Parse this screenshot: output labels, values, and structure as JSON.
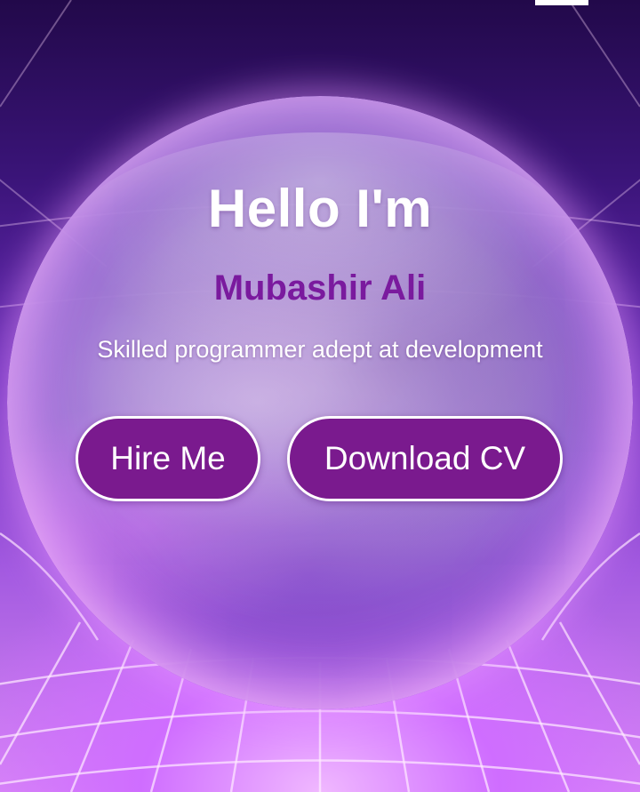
{
  "hero": {
    "greeting": "Hello I'm",
    "name": "Mubashir Ali",
    "tagline": "Skilled programmer adept at development"
  },
  "actions": {
    "hire_label": "Hire Me",
    "download_label": "Download CV"
  },
  "colors": {
    "accent": "#7a1a8e",
    "name_text": "#7a1a9e",
    "button_border": "#ffffff"
  }
}
